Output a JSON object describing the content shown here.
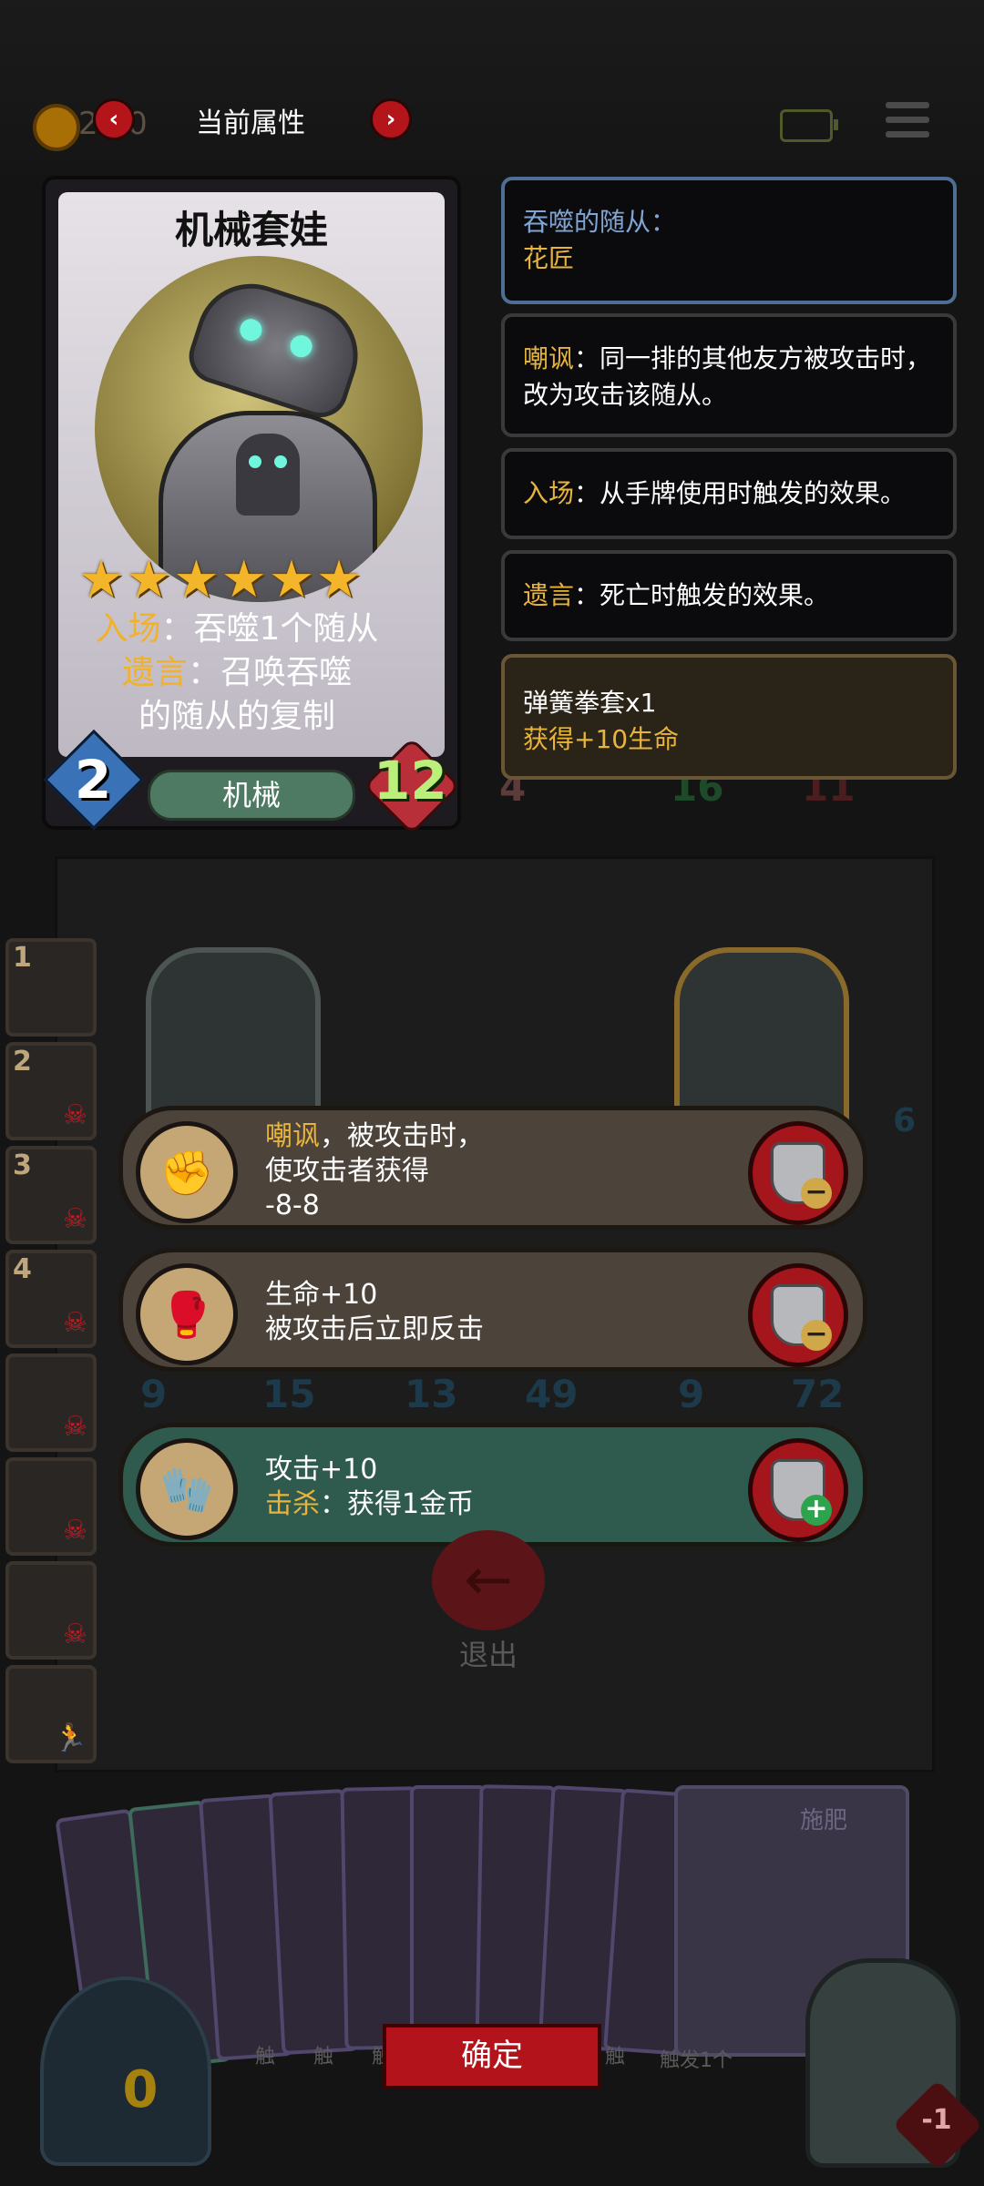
{
  "top_bar": {
    "title": "当前属性",
    "prev_icon": "‹",
    "next_icon": "›",
    "gold_amount": "2 20"
  },
  "card": {
    "name": "机械套娃",
    "stars": [
      "★",
      "★",
      "★",
      "★",
      "★",
      "★"
    ],
    "desc_line1_kw": "入场",
    "desc_line1_rest": "：吞噬1个随从",
    "desc_line2_kw": "遗言",
    "desc_line2_rest": "：召唤吞噬",
    "desc_line3": "的随从的复制",
    "attack": "2",
    "type": "机械",
    "health": "12"
  },
  "info_boxes": {
    "devoured_label": "吞噬的随从：",
    "devoured_value": "花匠",
    "taunt_kw": "嘲讽",
    "taunt_text": "：同一排的其他友方被攻击时，改为攻击该随从。",
    "entry_kw": "入场",
    "entry_text": "：从手牌使用时触发的效果。",
    "deathrattle_kw": "遗言",
    "deathrattle_text": "：死亡时触发的效果。",
    "item_name": "弹簧拳套x1",
    "item_effect": "获得+10生命"
  },
  "board": {
    "slot_numbers": [
      "1",
      "2",
      "3",
      "4"
    ],
    "stats_row1": {
      "skull_value": "4",
      "a": "16",
      "b": "11"
    },
    "stats_row2": {
      "a": "9",
      "b": "15",
      "c": "13",
      "d": "49",
      "e": "9",
      "f": "72"
    },
    "side_num": "6"
  },
  "effects": [
    {
      "kw": "嘲讽",
      "line1_rest": "，被攻击时，",
      "line2": "使攻击者获得",
      "line3": "-8-8",
      "action": "−"
    },
    {
      "line1": "生命+10",
      "line2": "被攻击后立即反击",
      "action": "−"
    },
    {
      "line1": "攻击+10",
      "line2_kw": "击杀",
      "line2_rest": "：获得1金币",
      "action": "+"
    }
  ],
  "exit_label": "退出",
  "hand": {
    "fertilizer_title": "施肥",
    "touch_labels": [
      "触",
      "触",
      "触",
      "触",
      "触发1个"
    ],
    "confirm_label": "确定",
    "pot_value": "0",
    "boss_hp": "-1"
  },
  "colors": {
    "accent_red": "#b3141b",
    "keyword_gold": "#f1b12d",
    "info_blue": "#7fa5d4",
    "effect_green": "#2f5a4e",
    "effect_brown": "#4c433a"
  }
}
